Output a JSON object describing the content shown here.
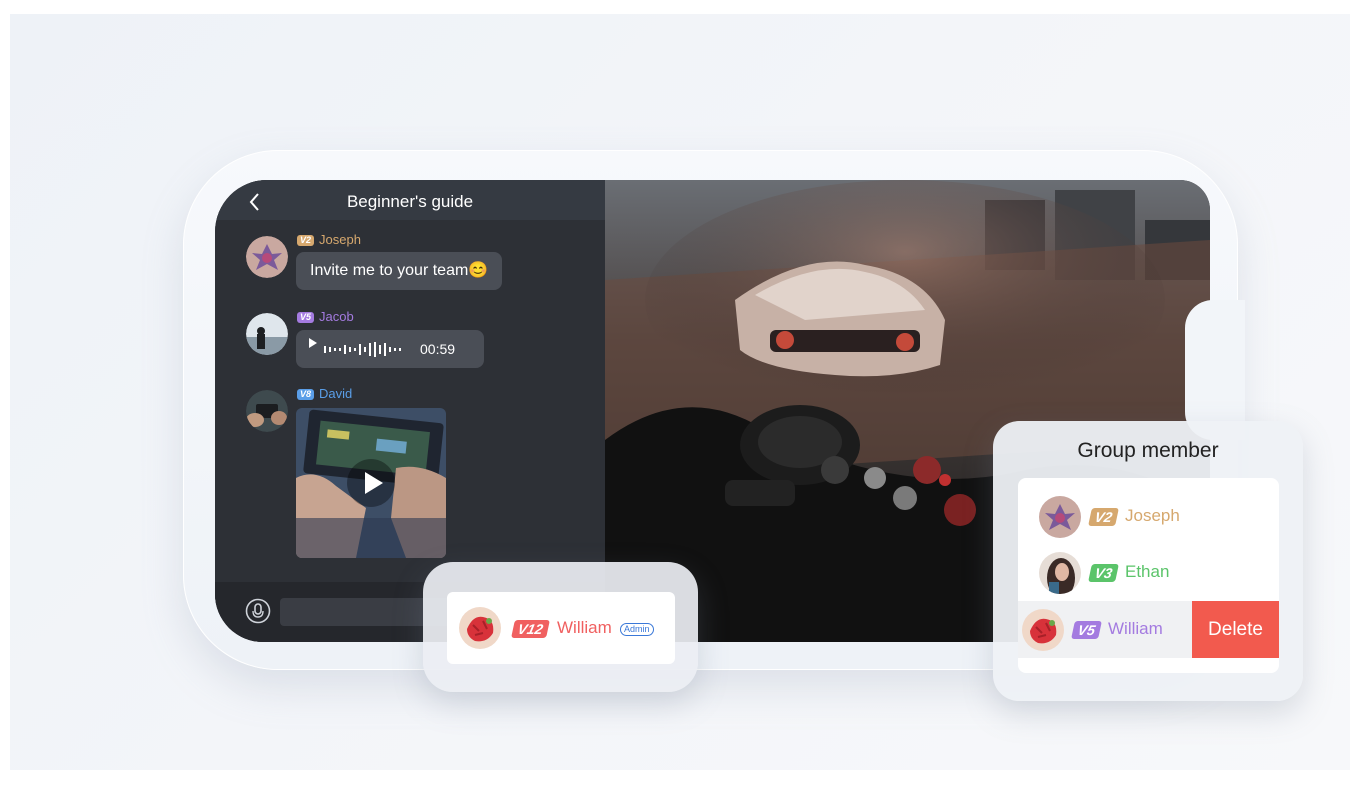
{
  "chat": {
    "title": "Beginner's guide",
    "messages": [
      {
        "level": "V2",
        "sender": "Joseph",
        "text": "Invite me to your team😊"
      },
      {
        "level": "V5",
        "sender": "Jacob",
        "duration": "00:59"
      },
      {
        "level": "V8",
        "sender": "David"
      }
    ]
  },
  "admin_card": {
    "level": "V12",
    "name": "William",
    "role": "Admin"
  },
  "group_member": {
    "title": "Group member",
    "members": [
      {
        "level": "V2",
        "name": "Joseph"
      },
      {
        "level": "V3",
        "name": "Ethan"
      },
      {
        "level": "V5",
        "name": "William"
      }
    ],
    "delete_label": "Delete"
  },
  "colors": {
    "level_v2": "#d6a86e",
    "level_v3": "#5bc46a",
    "level_v5": "#a47be0",
    "level_v8": "#5a9ee8",
    "level_v12": "#f06060",
    "delete": "#f25a4e"
  }
}
